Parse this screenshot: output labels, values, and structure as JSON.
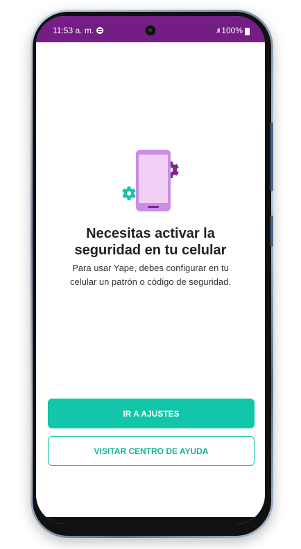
{
  "status_bar": {
    "time": "11:53 a. m.",
    "battery": "100%",
    "background_color": "#741d85"
  },
  "illustration": {
    "icon": "phone-settings-icon",
    "phone_color": "#c98ee6",
    "gear_purple": "#7b2a8e",
    "gear_green": "#12c6aa"
  },
  "content": {
    "title_line1": "Necesitas activar la",
    "title_line2": "seguridad en tu celular",
    "description_line1": "Para usar Yape, debes configurar en tu",
    "description_line2": "celular un patrón o código de seguridad."
  },
  "actions": {
    "primary_label": "IR A AJUSTES",
    "secondary_label": "VISITAR CENTRO DE AYUDA",
    "accent_color": "#12c6aa"
  }
}
